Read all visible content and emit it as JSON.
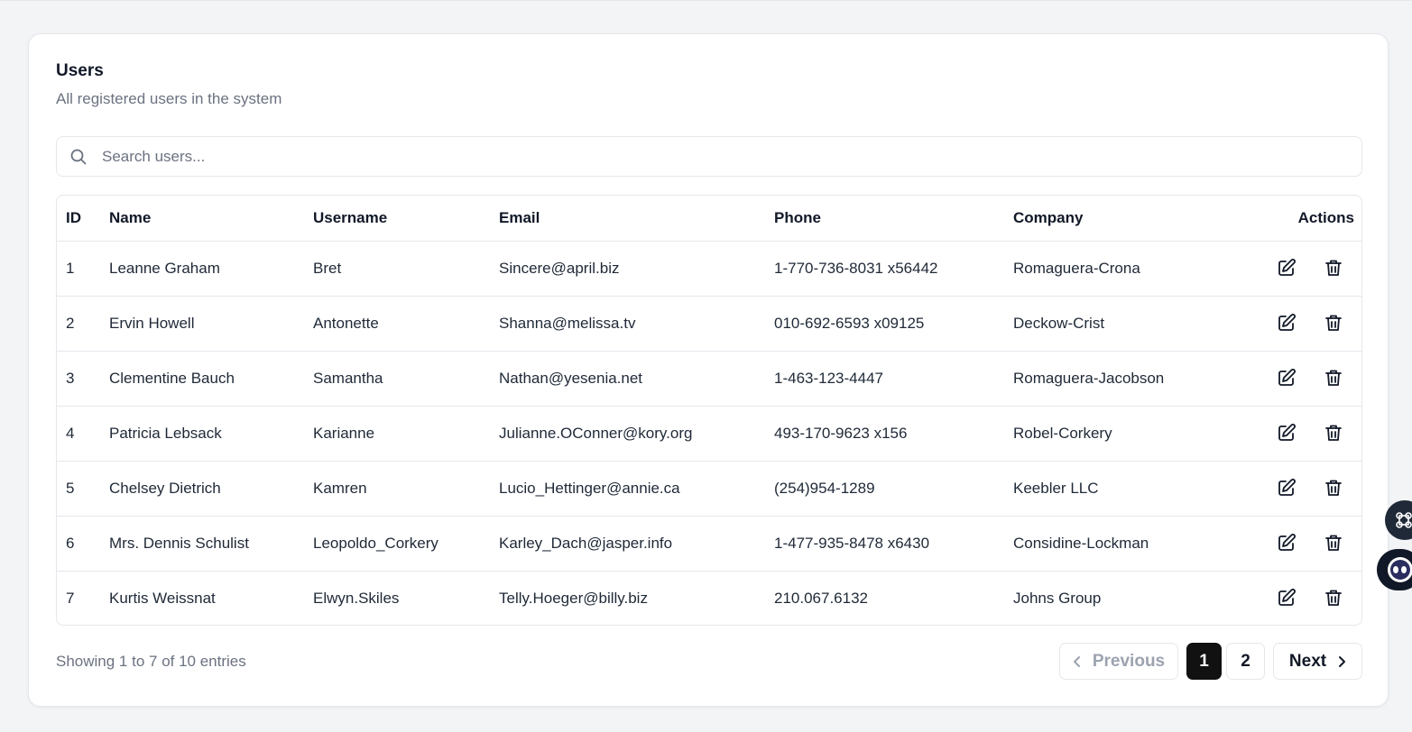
{
  "card": {
    "title": "Users",
    "subtitle": "All registered users in the system"
  },
  "search": {
    "placeholder": "Search users...",
    "value": ""
  },
  "table": {
    "columns": [
      "ID",
      "Name",
      "Username",
      "Email",
      "Phone",
      "Company",
      "Actions"
    ],
    "rows": [
      {
        "id": "1",
        "name": "Leanne Graham",
        "username": "Bret",
        "email": "Sincere@april.biz",
        "phone": "1-770-736-8031 x56442",
        "company": "Romaguera-Crona"
      },
      {
        "id": "2",
        "name": "Ervin Howell",
        "username": "Antonette",
        "email": "Shanna@melissa.tv",
        "phone": "010-692-6593 x09125",
        "company": "Deckow-Crist"
      },
      {
        "id": "3",
        "name": "Clementine Bauch",
        "username": "Samantha",
        "email": "Nathan@yesenia.net",
        "phone": "1-463-123-4447",
        "company": "Romaguera-Jacobson"
      },
      {
        "id": "4",
        "name": "Patricia Lebsack",
        "username": "Karianne",
        "email": "Julianne.OConner@kory.org",
        "phone": "493-170-9623 x156",
        "company": "Robel-Corkery"
      },
      {
        "id": "5",
        "name": "Chelsey Dietrich",
        "username": "Kamren",
        "email": "Lucio_Hettinger@annie.ca",
        "phone": "(254)954-1289",
        "company": "Keebler LLC"
      },
      {
        "id": "6",
        "name": "Mrs. Dennis Schulist",
        "username": "Leopoldo_Corkery",
        "email": "Karley_Dach@jasper.info",
        "phone": "1-477-935-8478 x6430",
        "company": "Considine-Lockman"
      },
      {
        "id": "7",
        "name": "Kurtis Weissnat",
        "username": "Elwyn.Skiles",
        "email": "Telly.Hoeger@billy.biz",
        "phone": "210.067.6132",
        "company": "Johns Group"
      }
    ],
    "row_actions": [
      "edit-icon",
      "trash-icon"
    ]
  },
  "footer": {
    "summary": "Showing 1 to 7 of 10 entries"
  },
  "pagination": {
    "previous_label": "Previous",
    "next_label": "Next",
    "pages": [
      "1",
      "2"
    ],
    "current_page": "1"
  },
  "floating": {
    "icons": [
      "command-icon",
      "assistant-icon"
    ]
  },
  "colors": {
    "background": "#f3f4f6",
    "active_page": "#111111",
    "muted_text": "#6b7280",
    "border": "#e5e7eb"
  }
}
